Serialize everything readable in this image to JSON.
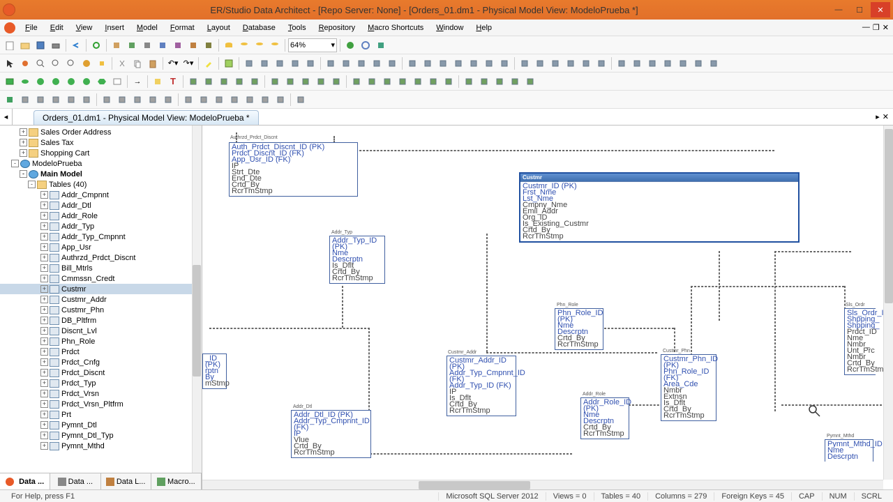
{
  "title": "ER/Studio Data Architect - [Repo Server: None] - [Orders_01.dm1 - Physical Model View: ModeloPrueba *]",
  "menu": [
    "File",
    "Edit",
    "View",
    "Insert",
    "Model",
    "Format",
    "Layout",
    "Database",
    "Tools",
    "Repository",
    "Macro Shortcuts",
    "Window",
    "Help"
  ],
  "zoom": "64%",
  "doc_tab": "Orders_01.dm1 - Physical Model View: ModeloPrueba *",
  "tree": {
    "top_nodes": [
      {
        "label": "Sales Order Address",
        "indent": 28,
        "icon": "folder",
        "toggle": "+"
      },
      {
        "label": "Sales Tax",
        "indent": 28,
        "icon": "folder",
        "toggle": "+"
      },
      {
        "label": "Shopping Cart",
        "indent": 28,
        "icon": "folder",
        "toggle": "+"
      },
      {
        "label": "ModeloPrueba",
        "indent": 16,
        "icon": "model",
        "toggle": "-"
      },
      {
        "label": "Main Model",
        "indent": 28,
        "icon": "model",
        "toggle": "-",
        "bold": true
      },
      {
        "label": "Tables (40)",
        "indent": 40,
        "icon": "folder",
        "toggle": "-"
      }
    ],
    "tables": [
      "Addr_Cmpnnt",
      "Addr_Dtl",
      "Addr_Role",
      "Addr_Typ",
      "Addr_Typ_Cmpnnt",
      "App_Usr",
      "Authrzd_Prdct_Discnt",
      "Bill_Mtrls",
      "Cmmssn_Credt",
      "Custmr",
      "Custmr_Addr",
      "Custmr_Phn",
      "DB_Pltfrm",
      "Discnt_Lvl",
      "Phn_Role",
      "Prdct",
      "Prdct_Cnfg",
      "Prdct_Discnt",
      "Prdct_Typ",
      "Prdct_Vrsn",
      "Prdct_Vrsn_Pltfrm",
      "Prt",
      "Pymnt_Dtl",
      "Pymnt_Dtl_Typ",
      "Pymnt_Mthd"
    ],
    "selected": "Custmr"
  },
  "tree_tabs": [
    "Data ...",
    "Data ...",
    "Data L...",
    "Macro..."
  ],
  "entities": {
    "authrzd": {
      "title": "Authrzd_Prdct_Discnt",
      "rows": [
        "Auth_Prdct_Discnt_ID (PK)",
        "Prdct_Discnt_ID (FK)",
        "App_Usr_ID (FK)",
        "IP",
        "Strt_Dte",
        "End_Dte",
        "Crtd_By",
        "RcrTmStmp"
      ]
    },
    "addr_typ": {
      "title": "Addr_Typ",
      "rows": [
        "Addr_Typ_ID (PK)",
        "Nme",
        "Descrptn",
        "Is_Dflt",
        "Crtd_By",
        "RcrTmStmp"
      ]
    },
    "custmr": {
      "title": "Custmr",
      "rows": [
        "Custmr_ID (PK)",
        "Frst_Nme",
        "Lst_Nme",
        "Cmpny_Nme",
        "Emil_Addr",
        "Org_ID",
        "Is_Existing_Custmr",
        "Crtd_By",
        "RcrTmStmp"
      ]
    },
    "phn_role": {
      "title": "Phn_Role",
      "rows": [
        "Phn_Role_ID (PK)",
        "Nme",
        "Descrptn",
        "Crtd_By",
        "RcrTmStmp"
      ]
    },
    "custmr_addr": {
      "title": "Custmr_Addr",
      "rows": [
        "Custmr_Addr_ID (PK)",
        "Addr_Typ_Cmpnnt_ID (FK)",
        "Addr_Typ_ID (FK)",
        "IP",
        "Is_Dflt",
        "Crtd_By",
        "RcrTmStmp"
      ]
    },
    "addr_role": {
      "title": "Addr_Role",
      "rows": [
        "Addr_Role_ID (PK)",
        "Nme",
        "Descrptn",
        "Crtd_By",
        "RcrTmStmp"
      ]
    },
    "custmr_phn": {
      "title": "Custmr_Phn",
      "rows": [
        "Custmr_Phn_ID (PK)",
        "Phn_Role_ID (FK)",
        "Area_Cde",
        "Nmbr",
        "Extnsn",
        "Is_Dflt",
        "Crtd_By",
        "RcrTmStmp"
      ]
    },
    "addr_dtl": {
      "title": "Addr_Dtl",
      "rows": [
        "Addr_Dtl_ID (PK)",
        "Addr_Typ_Cmpnnt_ID (FK)",
        "IP",
        "Vlue",
        "Crtd_By",
        "RcrTmStmp"
      ]
    },
    "sls_ordr": {
      "title": "Sls_Ordr",
      "rows": [
        "Sls_Ordr_ID",
        "Shpping_",
        "Shpping_",
        "Prdct_ID",
        "Nme",
        "Nmbr_",
        "Unt_Prc",
        "Nmbr_",
        "Crtd_By",
        "RcrTmStmp"
      ]
    },
    "pymnt_mthd": {
      "title": "Pymnt_Mthd",
      "rows": [
        "Pymnt_Mthd_ID",
        "Nme",
        "Descrptn"
      ]
    },
    "left_partial": {
      "rows": [
        "_ID (PK)",
        "rptn",
        "By",
        "mStmp"
      ]
    }
  },
  "status": {
    "help": "For Help, press F1",
    "db": "Microsoft SQL Server 2012",
    "views": "Views = 0",
    "tables": "Tables = 40",
    "columns": "Columns = 279",
    "fkeys": "Foreign Keys = 45",
    "cap": "CAP",
    "num": "NUM",
    "scrl": "SCRL"
  }
}
